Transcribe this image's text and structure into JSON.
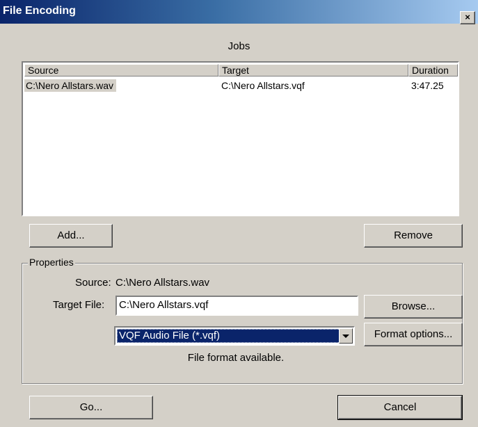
{
  "window": {
    "title": "File Encoding",
    "close_glyph": "×"
  },
  "jobs": {
    "label": "Jobs",
    "columns": [
      "Source",
      "Target",
      "Duration"
    ],
    "rows": [
      {
        "source": "C:\\Nero Allstars.wav",
        "target": "C:\\Nero Allstars.vqf",
        "duration": "3:47.25"
      }
    ]
  },
  "buttons": {
    "add": "Add...",
    "remove": "Remove",
    "browse": "Browse...",
    "format_options": "Format options...",
    "go": "Go...",
    "cancel": "Cancel"
  },
  "properties": {
    "group_label": "Properties",
    "source_label": "Source:",
    "source_value": "C:\\Nero Allstars.wav",
    "target_label": "Target File:",
    "target_value": "C:\\Nero Allstars.vqf",
    "format_selected": "VQF Audio File (*.vqf)",
    "status": "File format available."
  },
  "colors": {
    "face": "#d4d0c8",
    "selection": "#0a246a",
    "title_start": "#0a246a",
    "title_end": "#a6caf0"
  },
  "icons": {
    "dropdown": "chevron-down-icon",
    "close": "close-icon"
  }
}
